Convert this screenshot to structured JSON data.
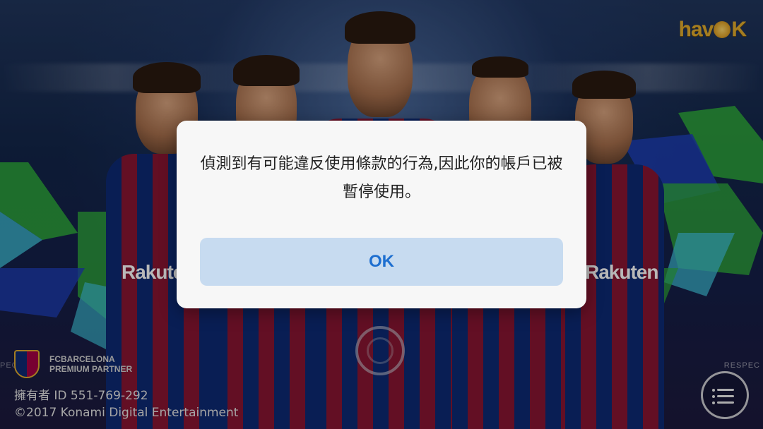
{
  "background": {
    "sponsor_text": "Rakuten",
    "corner_left_text": "PEC",
    "corner_right_text": "RESPEC"
  },
  "logo": {
    "text_before": "hav",
    "text_after": "K"
  },
  "dialog": {
    "message": "偵測到有可能違反使用條款的行為,因此你的帳戶已被暫停使用。",
    "ok_label": "OK"
  },
  "partner": {
    "line1": "FCBARCELONA",
    "line2": "PREMIUM PARTNER"
  },
  "footer": {
    "owner_id": "擁有者 ID 551-769-292",
    "copyright": "©2017 Konami Digital Entertainment"
  },
  "icons": {
    "menu": "list-menu-icon",
    "center": "ring-icon",
    "crest": "fc-barcelona-crest-icon"
  },
  "colors": {
    "dialog_bg": "#f7f7f7",
    "ok_bg": "#c7dbf0",
    "ok_text": "#1e6fd0",
    "logo": "#e3ad2e"
  }
}
